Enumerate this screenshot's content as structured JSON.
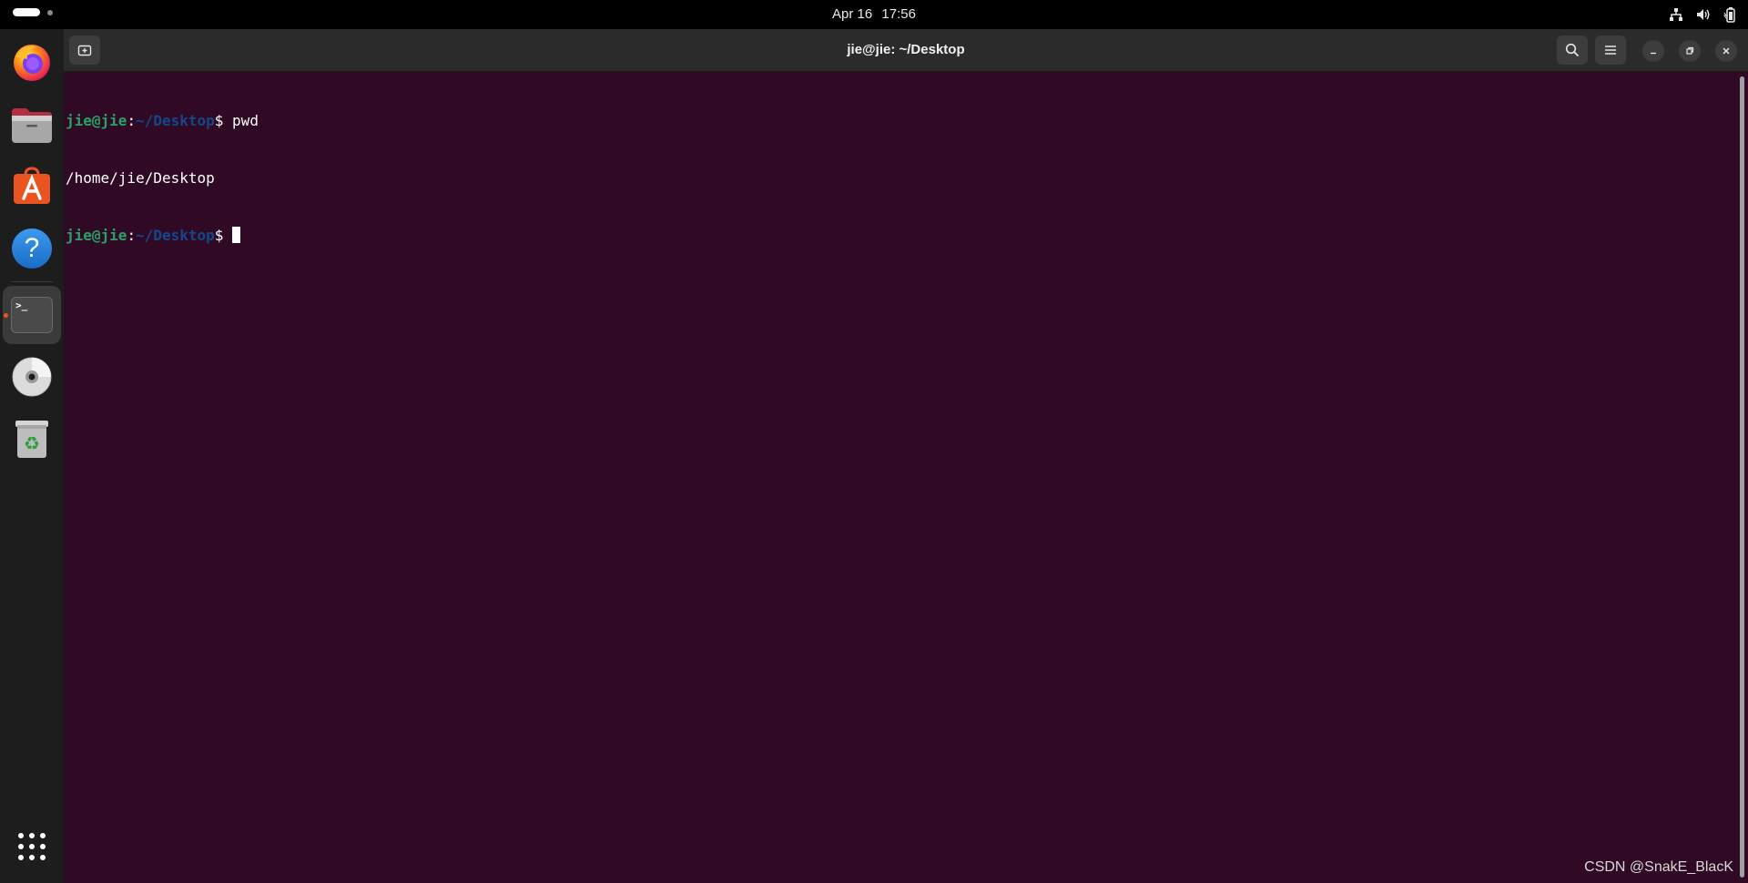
{
  "topbar": {
    "date": "Apr 16",
    "time": "17:56",
    "icons": [
      "network-icon",
      "volume-icon",
      "battery-icon"
    ]
  },
  "dock": {
    "apps": [
      {
        "name": "firefox",
        "icon": "firefox-icon"
      },
      {
        "name": "files",
        "icon": "files-icon"
      },
      {
        "name": "app-center",
        "icon": "app-center-icon"
      },
      {
        "name": "help",
        "icon": "help-icon"
      },
      {
        "name": "terminal",
        "icon": "terminal-icon",
        "active": true
      },
      {
        "name": "disc",
        "icon": "disc-icon"
      },
      {
        "name": "trash",
        "icon": "trash-icon"
      }
    ],
    "show_apps_icon": "app-grid-icon",
    "terminal_glyph": ">_",
    "help_glyph": "?"
  },
  "window": {
    "title": "jie@jie: ~/Desktop"
  },
  "terminal": {
    "lines": [
      {
        "user": "jie@jie",
        "sep": ":",
        "path": "~/Desktop",
        "prompt": "$ ",
        "command": "pwd"
      },
      {
        "output": "/home/jie/Desktop"
      },
      {
        "user": "jie@jie",
        "sep": ":",
        "path": "~/Desktop",
        "prompt": "$ ",
        "command": ""
      }
    ],
    "colors": {
      "background": "#300a24",
      "user": "#26a269",
      "path": "#12488b",
      "text": "#ffffff"
    }
  },
  "watermark": "CSDN @SnakE_BlacK"
}
